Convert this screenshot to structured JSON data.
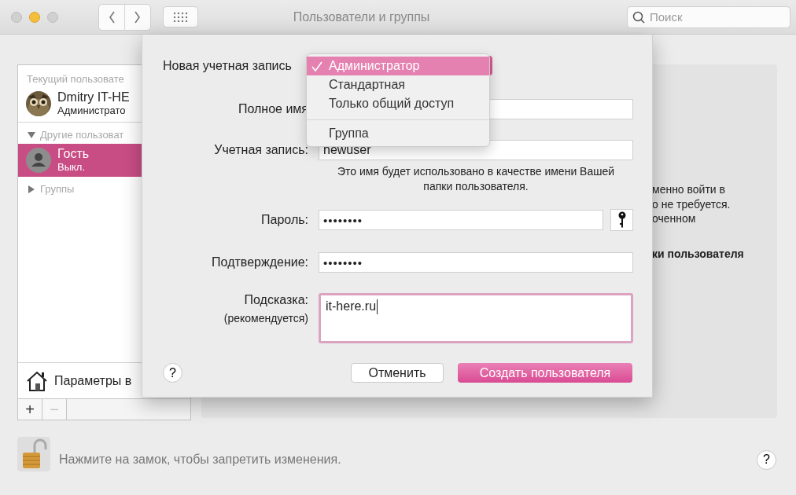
{
  "window": {
    "title": "Пользователи и группы",
    "search": {
      "placeholder": "Поиск"
    },
    "lights": [
      {
        "kind": "close",
        "active": false
      },
      {
        "kind": "minimize",
        "active": true
      },
      {
        "kind": "zoom",
        "active": false
      }
    ]
  },
  "sidebar": {
    "current_header": "Текущий пользовате",
    "current_users": [
      {
        "name": "Dmitry IT-HE",
        "role": "Администрато",
        "selected": false
      }
    ],
    "others_header": {
      "label": "Другие пользоват",
      "expanded": true
    },
    "other_users": [
      {
        "name": "Гость",
        "role": "Выкл.",
        "selected": true
      }
    ],
    "groups_header": {
      "label": "Группы",
      "expanded": false
    },
    "login_options": "Параметры в",
    "tools": [
      {
        "label": "+",
        "disabled": false
      },
      {
        "label": "−",
        "disabled": true
      }
    ]
  },
  "info_panel": {
    "lines": [
      {
        "text": "менно войти в",
        "bold": false
      },
      {
        "text": "о не требуется.",
        "bold": false
      },
      {
        "text": "оченном",
        "bold": false
      },
      {
        "text": "ки пользователя",
        "bold": true
      }
    ]
  },
  "sheet": {
    "account_type": {
      "label": "Новая учетная запись",
      "menu_groups": [
        [
          {
            "label": "Администратор",
            "selected": true
          },
          {
            "label": "Стандартная",
            "selected": false
          },
          {
            "label": "Только общий доступ",
            "selected": false
          }
        ],
        [
          {
            "label": "Группа",
            "selected": false
          }
        ]
      ]
    },
    "fields": [
      {
        "kind": "text",
        "label": "Полное имя"
      },
      {
        "kind": "text",
        "label": "Учетная запись:",
        "value": "newuser",
        "note": "Это имя будет использовано в качестве имени Вашей папки пользователя."
      },
      {
        "kind": "password",
        "label": "Пароль:",
        "value": "••••••••",
        "key_button": true
      },
      {
        "kind": "password",
        "label": "Подтверждение:",
        "value": "••••••••"
      },
      {
        "kind": "area",
        "label": "Подсказка:",
        "sublabel": "(рекомендуется)",
        "value": "it-here.ru",
        "focused": true
      }
    ],
    "buttons": [
      {
        "kind": "help",
        "label": "?"
      },
      {
        "kind": "cancel",
        "label": "Отменить"
      },
      {
        "kind": "default",
        "label": "Создать пользователя"
      }
    ]
  },
  "footer": {
    "locked": false,
    "text": "Нажмите на замок, чтобы запретить изменения.",
    "help": "?"
  }
}
